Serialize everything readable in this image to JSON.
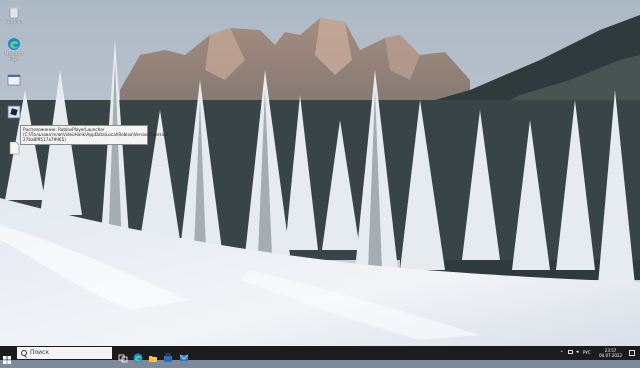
{
  "desktop": {
    "icons": [
      {
        "label": "Корзина",
        "icon": "recycle-bin-icon"
      },
      {
        "label": "Microsoft Edge",
        "icon": "edge-icon"
      },
      {
        "label": "",
        "icon": "shortcut-icon"
      },
      {
        "label": "",
        "icon": "roblox-player-icon"
      },
      {
        "label": "",
        "icon": "file-icon"
      }
    ],
    "tooltip": "Расположение: RobloxPlayerLauncher (C:\\Пользователи\\VideoHolik\\AppData\\Local\\Roblox\\Versions\\version-27ba8f9517a79965)"
  },
  "taskbar": {
    "search_placeholder": "Поиск",
    "apps": [
      "task-view-icon",
      "edge-icon",
      "file-explorer-icon",
      "store-icon",
      "mail-icon"
    ],
    "tray_lang": "РУС",
    "time": "23:57",
    "date": "04.07.2022"
  }
}
